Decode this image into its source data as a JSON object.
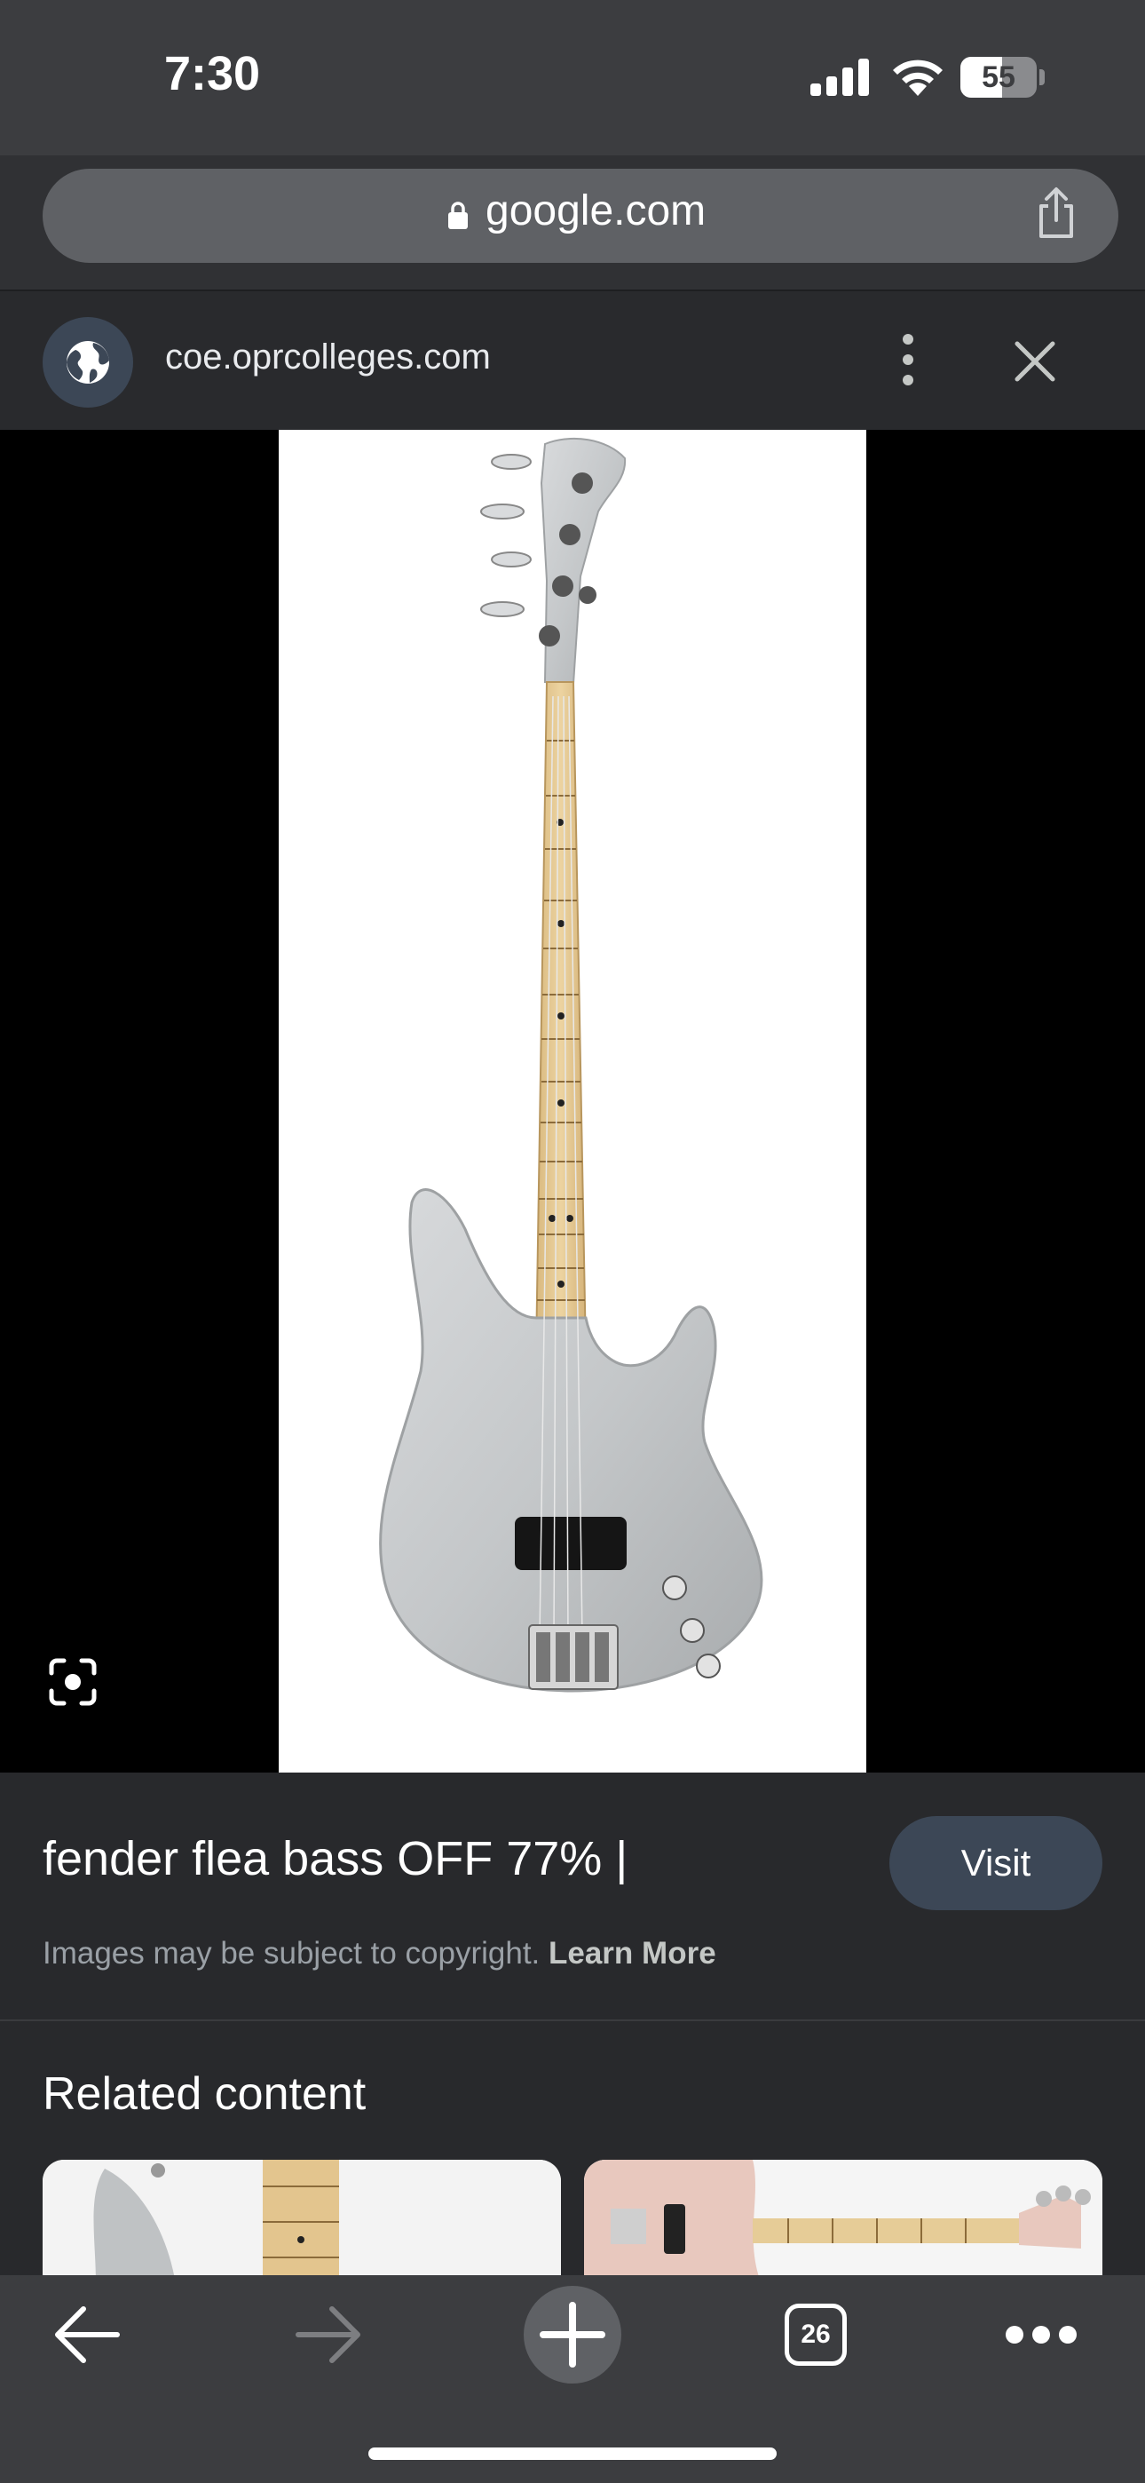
{
  "status_bar": {
    "time": "7:30",
    "battery_level": "55"
  },
  "browser": {
    "url": "google.com",
    "source_domain": "coe.oprcolleges.com",
    "tab_count": "26"
  },
  "result": {
    "title": "fender flea bass OFF 77% |",
    "visit_label": "Visit",
    "copyright_text": "Images may be subject to copyright. ",
    "learn_more_label": "Learn More"
  },
  "related": {
    "title": "Related content"
  },
  "icons": {
    "lock": "lock-icon",
    "share": "share-icon",
    "globe": "globe-icon",
    "more": "more-vert-icon",
    "close": "close-icon",
    "lens": "lens-icon",
    "back": "back-icon",
    "forward": "forward-icon",
    "new_tab": "plus-icon",
    "menu": "more-horiz-icon"
  },
  "colors": {
    "chrome": "#3c3d40",
    "panel": "#28292c",
    "button": "#3c4756",
    "bass_body": "#c6c9cb",
    "maple": "#e2c58f"
  }
}
